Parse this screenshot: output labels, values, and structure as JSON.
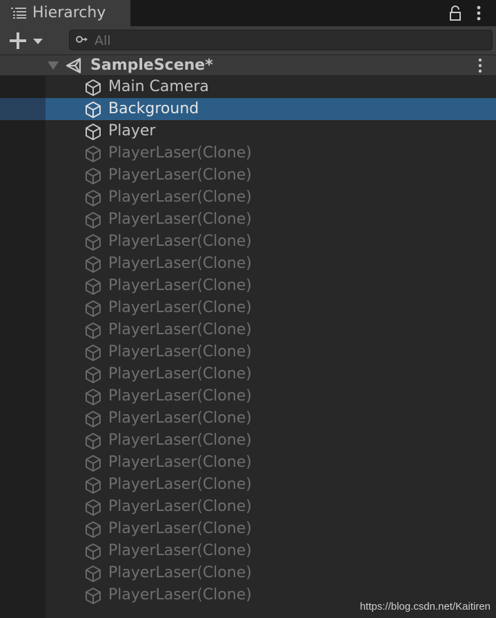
{
  "window": {
    "tab_title": "Hierarchy",
    "tab_icon": "hierarchy-list-icon",
    "lock_icon": "lock-icon",
    "more_icon": "kebab-menu-icon"
  },
  "toolbar": {
    "add_icon": "plus-dropdown-icon",
    "search_placeholder": "All",
    "search_value": "",
    "search_icon": "search-icon"
  },
  "scene": {
    "name": "SampleScene*",
    "expanded": true,
    "icon": "unity-logo-icon"
  },
  "items": [
    {
      "label": "Main Camera",
      "active": true,
      "selected": false
    },
    {
      "label": "Background",
      "active": true,
      "selected": true
    },
    {
      "label": "Player",
      "active": true,
      "selected": false
    },
    {
      "label": "PlayerLaser(Clone)",
      "active": false,
      "selected": false
    },
    {
      "label": "PlayerLaser(Clone)",
      "active": false,
      "selected": false
    },
    {
      "label": "PlayerLaser(Clone)",
      "active": false,
      "selected": false
    },
    {
      "label": "PlayerLaser(Clone)",
      "active": false,
      "selected": false
    },
    {
      "label": "PlayerLaser(Clone)",
      "active": false,
      "selected": false
    },
    {
      "label": "PlayerLaser(Clone)",
      "active": false,
      "selected": false
    },
    {
      "label": "PlayerLaser(Clone)",
      "active": false,
      "selected": false
    },
    {
      "label": "PlayerLaser(Clone)",
      "active": false,
      "selected": false
    },
    {
      "label": "PlayerLaser(Clone)",
      "active": false,
      "selected": false
    },
    {
      "label": "PlayerLaser(Clone)",
      "active": false,
      "selected": false
    },
    {
      "label": "PlayerLaser(Clone)",
      "active": false,
      "selected": false
    },
    {
      "label": "PlayerLaser(Clone)",
      "active": false,
      "selected": false
    },
    {
      "label": "PlayerLaser(Clone)",
      "active": false,
      "selected": false
    },
    {
      "label": "PlayerLaser(Clone)",
      "active": false,
      "selected": false
    },
    {
      "label": "PlayerLaser(Clone)",
      "active": false,
      "selected": false
    },
    {
      "label": "PlayerLaser(Clone)",
      "active": false,
      "selected": false
    },
    {
      "label": "PlayerLaser(Clone)",
      "active": false,
      "selected": false
    },
    {
      "label": "PlayerLaser(Clone)",
      "active": false,
      "selected": false
    },
    {
      "label": "PlayerLaser(Clone)",
      "active": false,
      "selected": false
    },
    {
      "label": "PlayerLaser(Clone)",
      "active": false,
      "selected": false
    },
    {
      "label": "PlayerLaser(Clone)",
      "active": false,
      "selected": false
    }
  ],
  "watermark": "https://blog.csdn.net/Kaitiren",
  "colors": {
    "selection": "#2c5d87",
    "active_text": "#c4c4c4",
    "inactive_text": "#6f6f6f",
    "panel_bg": "#282828"
  }
}
